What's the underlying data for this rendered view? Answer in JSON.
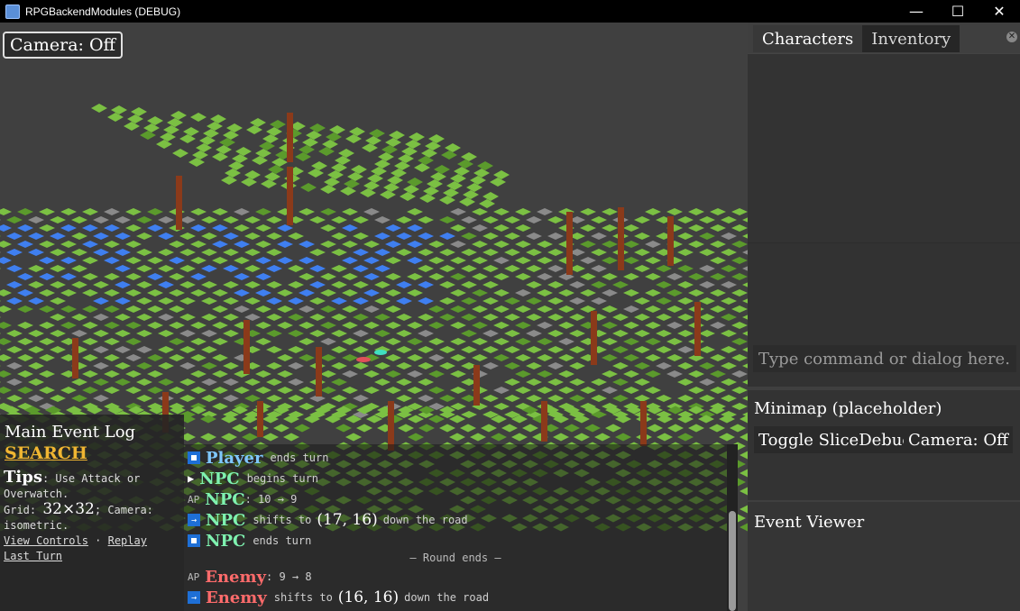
{
  "window": {
    "title": "RPGBackendModules (DEBUG)",
    "minimize_glyph": "—",
    "maximize_glyph": "☐",
    "close_glyph": "✕"
  },
  "viewport": {
    "camera_button": "Camera: Off",
    "colors": {
      "grass": "#7bc043",
      "grass_dark": "#5b9a2c",
      "water": "#3f7ff0",
      "stone": "#8a8a8a",
      "trunk": "#8b3a1a",
      "background": "#404040"
    }
  },
  "right_panel": {
    "tabs": [
      "Characters",
      "Inventory"
    ],
    "active_tab": 0,
    "command_placeholder": "Type command or dialog here...",
    "minimap_title": "Minimap (placeholder)",
    "toggle_slice_button": "Toggle SliceDebug",
    "camera_button": "Camera: Off",
    "event_viewer_title": "Event Viewer"
  },
  "log_sidebar": {
    "title": "Main Event Log",
    "search_label": "SEARCH",
    "tips_head": "Tips",
    "tips_text": ": Use Attack or Overwatch.",
    "grid_label": "Grid: ",
    "grid_value": "32×32",
    "camera_text": "; Camera: isometric.",
    "view_controls": "View Controls",
    "separator": " · ",
    "replay_last_turn": "Replay Last Turn"
  },
  "event_log": {
    "lines": [
      {
        "icon": "square",
        "name": "Player",
        "kind": "player",
        "text": "ends turn"
      },
      {
        "icon": "play",
        "name": "NPC",
        "kind": "npc",
        "text": "begins turn"
      },
      {
        "icon": "ap",
        "icon_text": "AP",
        "name": "NPC",
        "kind": "npc",
        "text": ": 10 → 9"
      },
      {
        "icon": "arrow",
        "name": "NPC",
        "kind": "npc",
        "text": "shifts to",
        "coord": "(17, 16)",
        "suffix": "down the road"
      },
      {
        "icon": "square",
        "name": "NPC",
        "kind": "npc",
        "text": "ends turn"
      },
      {
        "icon": "round",
        "text": "— Round ends —"
      },
      {
        "icon": "ap",
        "icon_text": "AP",
        "name": "Enemy",
        "kind": "enemy",
        "text": ": 9 → 8"
      },
      {
        "icon": "arrow",
        "name": "Enemy",
        "kind": "enemy",
        "text": "shifts to",
        "coord": "(16, 16)",
        "suffix": "down the road"
      }
    ]
  }
}
